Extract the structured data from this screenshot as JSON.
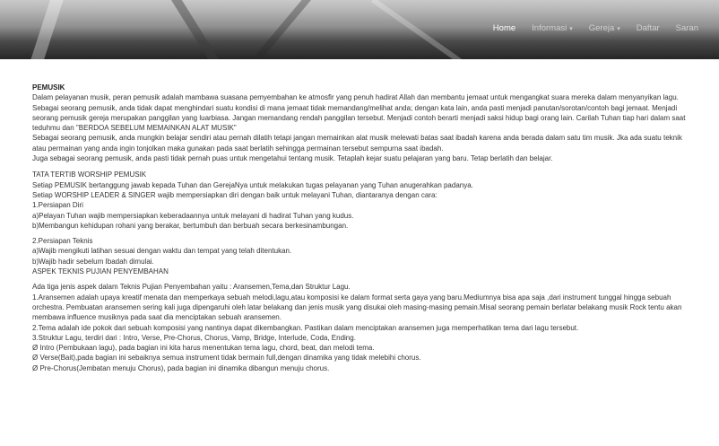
{
  "nav": {
    "items": [
      {
        "label": "Home",
        "dropdown": false,
        "active": true
      },
      {
        "label": "Informasi",
        "dropdown": true,
        "active": false
      },
      {
        "label": "Gereja",
        "dropdown": true,
        "active": false
      },
      {
        "label": "Daftar",
        "dropdown": false,
        "active": false
      },
      {
        "label": "Saran",
        "dropdown": false,
        "active": false
      }
    ]
  },
  "content": {
    "title": "PEMUSIK",
    "intro": [
      "Dalam pelayanan musik, peran pemusik adalah mambawa suasana pemyembahan ke atmosfir yang penuh hadirat Allah dan membantu jemaat untuk mengangkat suara mereka dalam menyanyikan lagu.",
      "Sebagai seorang pemusik, anda tidak dapat menghindari suatu kondisi di mana jemaat tidak memandang/melihat anda; dengan kata lain, anda pasti menjadi panutan/sorotan/contoh bagi jemaat. Menjadi seorang pemusik gereja merupakan panggilan yang luarbiasa. Jangan memandang rendah panggilan tersebut. Menjadi contoh berarti menjadi saksi hidup bagi orang lain. Carilah Tuhan tiap hari dalam saat teduhmu dan \"BERDOA SEBELUM MEMAINKAN ALAT MUSIK\"",
      "Sebagai seorang pemusik, anda mungkin belajar sendiri atau pernah dilatih tetapi jangan memainkan alat musik melewati batas saat ibadah karena anda berada dalam satu tim musik. Jka ada suatu teknik atau permainan yang anda ingin tonjolkan maka gunakan pada saat berlatih sehingga permainan tersebut sempurna saat ibadah.",
      "Juga sebagai seorang pemusik, anda pasti tidak pernah puas untuk mengetahui tentang musik. Tetaplah kejar suatu pelajaran yang baru. Tetap berlatih dan belajar."
    ],
    "tata_tertib": [
      "TATA TERTIB WORSHIP PEMUSIK",
      "Setiap PEMUSIK bertanggung jawab kepada Tuhan dan GerejaNya untuk melakukan tugas pelayanan yang Tuhan anugerahkan padanya.",
      "Setiap WORSHIP LEADER & SINGER wajib mempersiapkan diri dengan baik untuk melayani Tuhan, diantaranya dengan cara:",
      "1.Persiapan Diri",
      "a)Pelayan Tuhan wajib mempersiapkan keberadaannya untuk melayani di hadirat Tuhan yang kudus.",
      "b)Membangun kehidupan rohani yang berakar, bertumbuh dan berbuah secara berkesinambungan."
    ],
    "persiapan_teknis": [
      "2.Persiapan Teknis",
      "a)Wajib mengikuti latihan sesuai dengan waktu dan tempat yang telah ditentukan.",
      "b)Wajib hadir sebelum Ibadah dimulai."
    ],
    "aspek_heading": "ASPEK TEKNIS PUJIAN PENYEMBAHAN",
    "aspek": [
      "Ada tiga jenis aspek dalam Teknis Pujian Penyembahan yaitu : Aransemen,Tema,dan Struktur Lagu.",
      "1.Aransemen adalah upaya kreatif menata dan memperkaya sebuah melodi,lagu,atau komposisi ke dalam format serta gaya yang baru.Mediumnya bisa apa saja ,dari instrument tunggal hingga sebuah orchestra. Pembuatan aransemen sering kali juga dipengaruhi oleh latar belakang dan jenis musik yang disukai oleh masing-masing pemain.Misal seorang pemain berlatar belakang musik Rock tentu akan membawa influence musiknya pada saat dia menciptakan sebuah aransemen.",
      "2.Tema adalah ide pokok dari sebuah komposisi yang nantinya dapat dikembangkan. Pastikan dalam menciptakan aransemen juga memperhatikan tema dari lagu tersebut.",
      "3.Struktur Lagu, terdiri dari : Intro, Verse, Pre-Chorus, Chorus, Vamp, Bridge, Interlude, Coda, Ending.",
      "Ø Intro (Pembukaan lagu), pada bagian ini kita harus menentukan tema lagu, chord, beat, dan melodi tema.",
      "Ø Verse(Bait),pada bagian ini sebaiknya semua instrument tidak bermain full,dengan dinamika yang tidak melebihi chorus.",
      "Ø Pre-Chorus(Jembatan menuju Chorus), pada bagian ini dinamika dibangun menuju chorus."
    ]
  }
}
